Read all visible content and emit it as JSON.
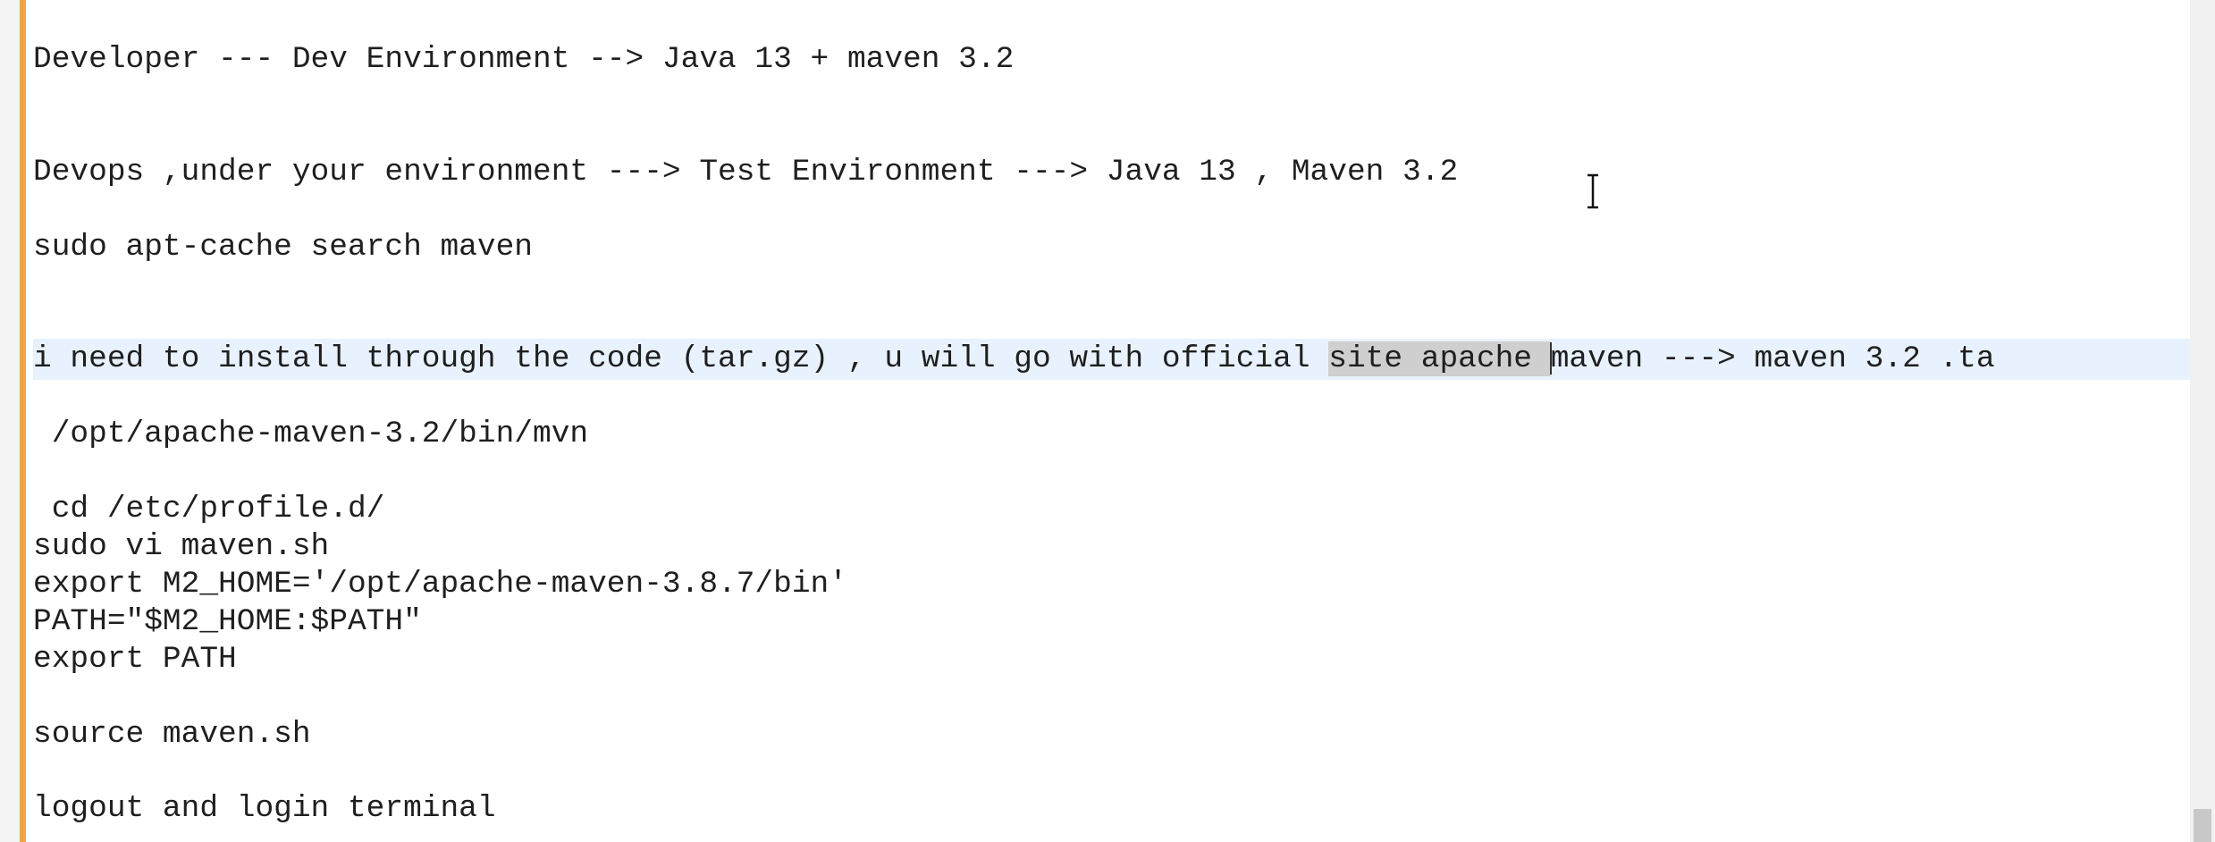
{
  "editor": {
    "lines": [
      "Developer --- Dev Environment --> Java 13 + maven 3.2",
      "Devops ,under your environment ---> Test Environment ---> Java 13 , Maven 3.2",
      "sudo apt-cache search maven",
      "i need to install through the code (tar.gz) , u will go with official ",
      "site apache ",
      "maven ---> maven 3.2 .ta",
      " /opt/apache-maven-3.2/bin/mvn",
      " cd /etc/profile.d/",
      "sudo vi maven.sh",
      "export M2_HOME='/opt/apache-maven-3.8.7/bin'",
      "PATH=\"$M2_HOME:$PATH\"",
      "export PATH",
      "source maven.sh",
      "logout and login terminal"
    ]
  },
  "colors": {
    "change_bar": "#f5a14a",
    "current_line": "#e8f2fe",
    "selection": "#cfcfcf"
  },
  "icons": {
    "mouse_cursor": "text-cursor-icon"
  }
}
